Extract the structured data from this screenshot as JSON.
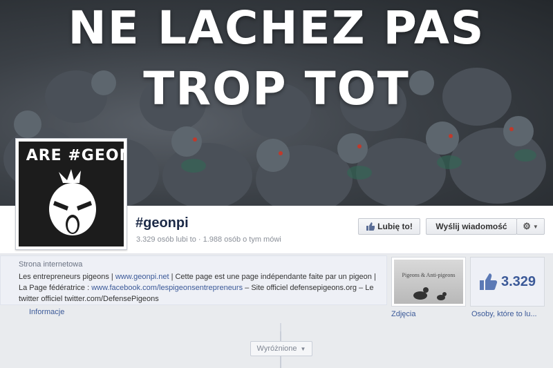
{
  "cover": {
    "line1": "NE LACHEZ PAS",
    "line2": "TROP TOT"
  },
  "profile": {
    "picture_text": "E ARE #GEON"
  },
  "page": {
    "name": "#geonpi",
    "stats": "3.329 osób lubi to · 1.988 osób o tym mówi"
  },
  "actions": {
    "like_label": "Lubię to!",
    "message_label": "Wyślij wiadomość",
    "settings_icon": "gear-icon"
  },
  "about": {
    "label": "Strona internetowa",
    "text_1": "Les entrepreneurs pigeons | ",
    "link_1": "www.geonpi.net",
    "text_2": " | Cette page est une page indépendante faite par un pigeon | La Page fédératrice : ",
    "link_2": "www.facebook.com/lespigeonsentrepreneurs",
    "text_3": " – Site officiel defensepigeons.org – Le twitter officiel twitter.com/DefensePigeons",
    "info_link": "Informacje"
  },
  "photos": {
    "caption": "Pigeons & Anti-pigeons",
    "label": "Zdjęcia"
  },
  "likes": {
    "count": "3.329",
    "label": "Osoby, które to lu..."
  },
  "timeline": {
    "featured_label": "Wyróżnione"
  },
  "colors": {
    "link": "#3b5998",
    "title": "#1c2a47",
    "background": "#e9ebee"
  }
}
